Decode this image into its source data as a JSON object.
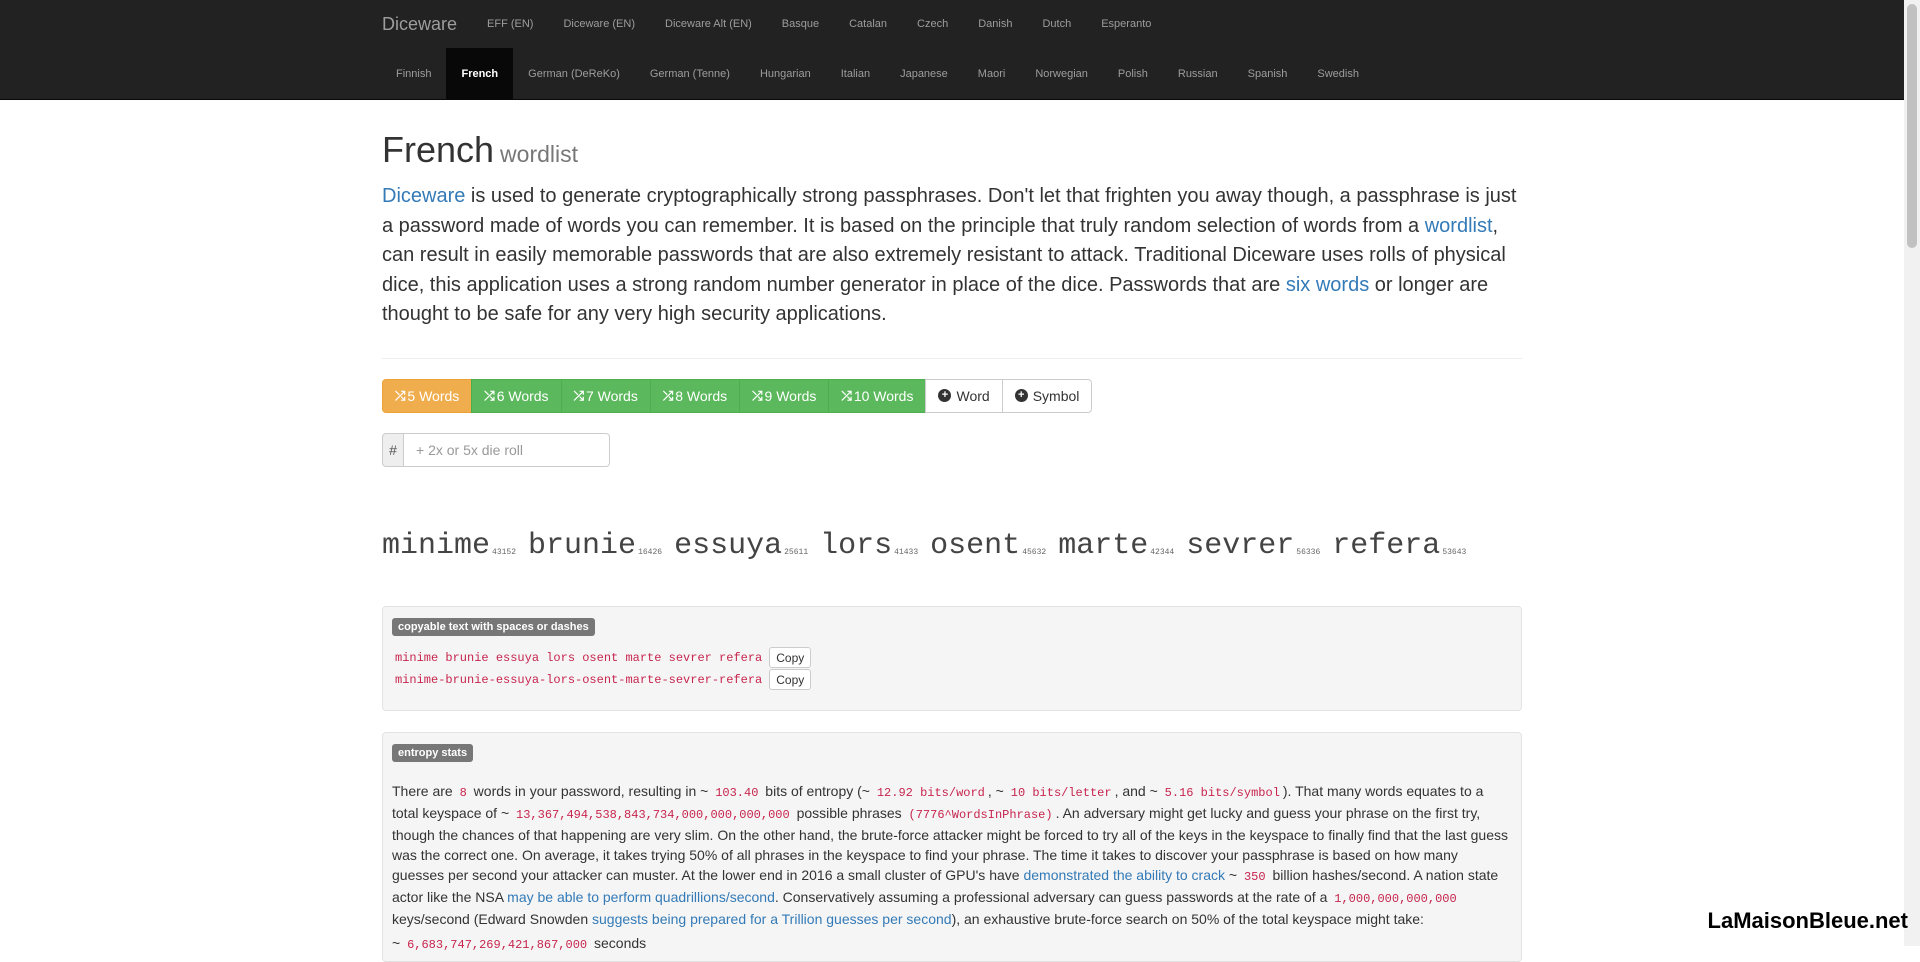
{
  "navbar": {
    "brand": "Diceware",
    "row1": [
      "EFF (EN)",
      "Diceware (EN)",
      "Diceware Alt (EN)",
      "Basque",
      "Catalan",
      "Czech",
      "Danish",
      "Dutch",
      "Esperanto"
    ],
    "row2": [
      "Finnish",
      "French",
      "German (DeReKo)",
      "German (Tenne)",
      "Hungarian",
      "Italian",
      "Japanese",
      "Maori",
      "Norwegian",
      "Polish",
      "Russian",
      "Spanish",
      "Swedish"
    ],
    "active": "French"
  },
  "page": {
    "title": "French",
    "subtitle": "wordlist"
  },
  "intro": {
    "link_diceware": "Diceware",
    "t1": " is used to generate cryptographically strong passphrases. Don't let that frighten you away though, a passphrase is just a password made of words you can remember. It is based on the principle that truly random selection of words from a ",
    "link_wordlist": "wordlist",
    "t2": ", can result in easily memorable passwords that are also extremely resistant to attack. Traditional Diceware uses rolls of physical dice, this application uses a strong random number generator in place of the dice. Passwords that are ",
    "link_six_words": "six words",
    "t3": " or longer are thought to be safe for any very high security applications."
  },
  "buttons": {
    "w5": "5 Words",
    "w6": "6 Words",
    "w7": "7 Words",
    "w8": "8 Words",
    "w9": "9 Words",
    "w10": "10 Words",
    "add_word": "Word",
    "add_symbol": "Symbol"
  },
  "die_input": {
    "addon": "#",
    "placeholder": "+ 2x or 5x die roll"
  },
  "passphrase": [
    {
      "word": "minime",
      "roll": "43152"
    },
    {
      "word": "brunie",
      "roll": "16426"
    },
    {
      "word": "essuya",
      "roll": "25611"
    },
    {
      "word": "lors",
      "roll": "41433"
    },
    {
      "word": "osent",
      "roll": "45632"
    },
    {
      "word": "marte",
      "roll": "42344"
    },
    {
      "word": "sevrer",
      "roll": "56336"
    },
    {
      "word": "refera",
      "roll": "53643"
    }
  ],
  "copy_section": {
    "label": "copyable text with spaces or dashes",
    "spaces": "minime brunie essuya lors osent marte sevrer refera",
    "dashes": "minime-brunie-essuya-lors-osent-marte-sevrer-refera",
    "copy_label": "Copy"
  },
  "entropy": {
    "label": "entropy stats",
    "p1": "There are ",
    "words": "8",
    "p2": " words in your password, resulting in ~ ",
    "bits": "103.40",
    "p3": " bits of entropy (~ ",
    "bits_word": "12.92 bits/word",
    "p4": ", ~ ",
    "bits_letter": "10 bits/letter",
    "p5": ", and ~ ",
    "bits_symbol": "5.16 bits/symbol",
    "p6": "). That many words equates to a total keyspace of ~ ",
    "keyspace": "13,367,494,538,843,734,000,000,000,000",
    "p7": " possible phrases ",
    "formula": "(7776^WordsInPhrase)",
    "p8": ". An adversary might get lucky and guess your phrase on the first try, though the chances of that happening are very slim. On the other hand, the brute-force attacker might be forced to try all of the keys in the keyspace to finally find that the last guess was the correct one. On average, it takes trying 50% of all phrases in the keyspace to find your phrase. The time it takes to discover your passphrase is based on how many guesses per second your attacker can muster. At the lower end in 2016 a small cluster of GPU's have ",
    "link_crack": "demonstrated the ability to crack",
    "p9": " ~ ",
    "hashes": "350",
    "p10": " billion hashes/second. A nation state actor like the NSA ",
    "link_nsa": "may be able to perform quadrillions/second",
    "p11": ". Conservatively assuming a professional adversary can guess passwords at the rate of a ",
    "rate": "1,000,000,000,000",
    "p12": " keys/second (Edward Snowden ",
    "link_snowden": "suggests being prepared for a Trillion guesses per second",
    "p13": "), an exhaustive brute-force search on 50% of the total keyspace might take:",
    "seconds_prefix": "~ ",
    "seconds": "6,683,747,269,421,867,000",
    "seconds_suffix": " seconds"
  },
  "watermark": "LaMaisonBleue.net"
}
